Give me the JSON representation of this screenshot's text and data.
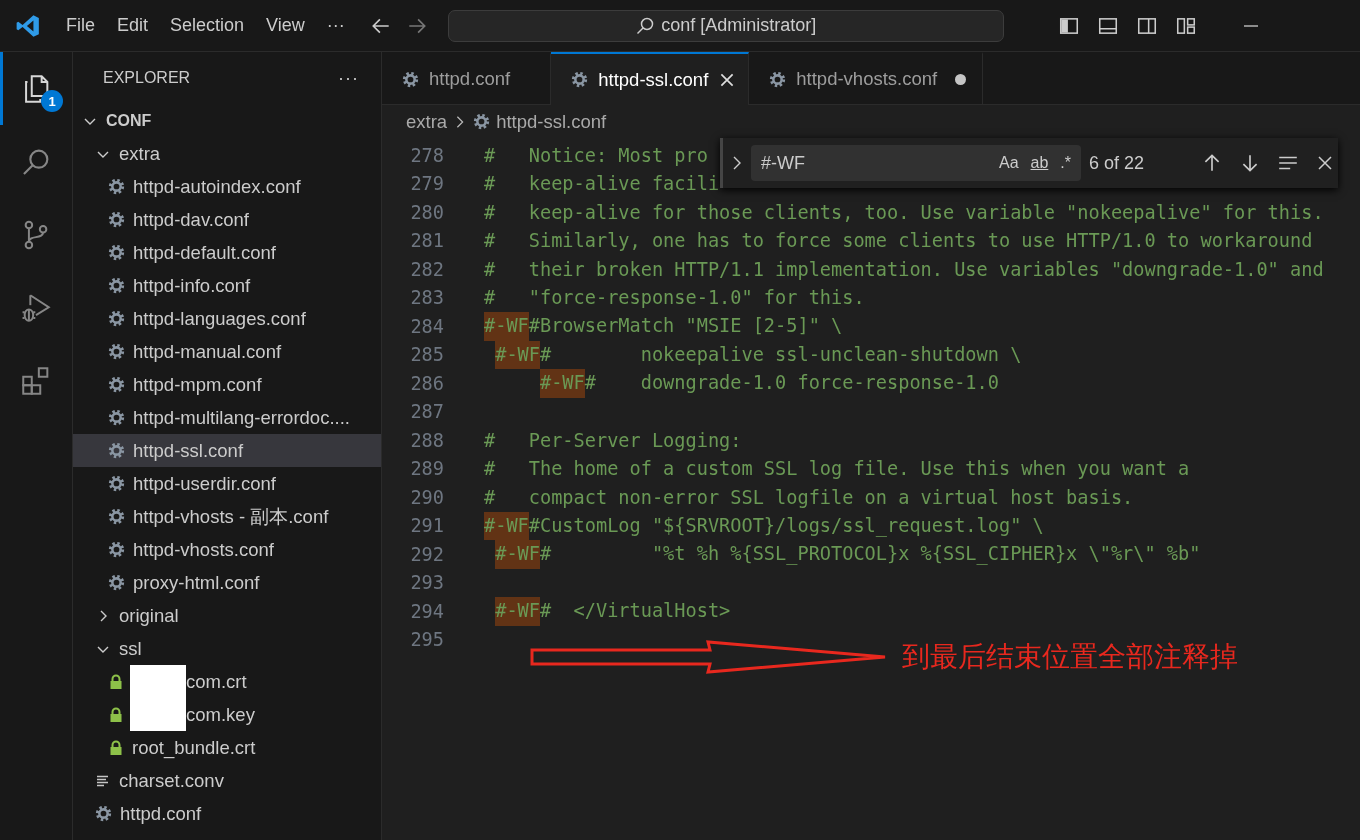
{
  "title_bar": {
    "menu": [
      "File",
      "Edit",
      "Selection",
      "View",
      "···"
    ],
    "command_center": "conf [Administrator]"
  },
  "activity_bar": [
    {
      "kind": "explorer",
      "selected": true,
      "badge": "1"
    },
    {
      "kind": "search",
      "selected": false
    },
    {
      "kind": "source-control",
      "selected": false
    },
    {
      "kind": "run-debug",
      "selected": false
    },
    {
      "kind": "extensions",
      "selected": false
    }
  ],
  "sidebar": {
    "title": "EXPLORER",
    "more": "···",
    "tree": [
      {
        "label": "CONF",
        "kind": "root",
        "expanded": true,
        "selected": false,
        "children": [
          {
            "label": "extra",
            "kind": "folder",
            "expanded": true,
            "selected": false,
            "children": [
              {
                "label": "httpd-autoindex.conf",
                "kind": "config",
                "selected": false
              },
              {
                "label": "httpd-dav.conf",
                "kind": "config",
                "selected": false
              },
              {
                "label": "httpd-default.conf",
                "kind": "config",
                "selected": false
              },
              {
                "label": "httpd-info.conf",
                "kind": "config",
                "selected": false
              },
              {
                "label": "httpd-languages.conf",
                "kind": "config",
                "selected": false
              },
              {
                "label": "httpd-manual.conf",
                "kind": "config",
                "selected": false
              },
              {
                "label": "httpd-mpm.conf",
                "kind": "config",
                "selected": false
              },
              {
                "label": "httpd-multilang-errordoc....",
                "kind": "config",
                "selected": false
              },
              {
                "label": "httpd-ssl.conf",
                "kind": "config",
                "selected": true
              },
              {
                "label": "httpd-userdir.conf",
                "kind": "config",
                "selected": false
              },
              {
                "label": "httpd-vhosts - 副本.conf",
                "kind": "config",
                "selected": false
              },
              {
                "label": "httpd-vhosts.conf",
                "kind": "config",
                "selected": false
              },
              {
                "label": "proxy-html.conf",
                "kind": "config",
                "selected": false
              }
            ]
          },
          {
            "label": "original",
            "kind": "folder",
            "expanded": false,
            "selected": false
          },
          {
            "label": "ssl",
            "kind": "folder",
            "expanded": true,
            "selected": false,
            "children": [
              {
                "label": "com.crt",
                "kind": "certificate",
                "redacted": true,
                "selected": false
              },
              {
                "label": "com.key",
                "kind": "certificate",
                "redacted": true,
                "selected": false
              },
              {
                "label": "root_bundle.crt",
                "kind": "certificate",
                "redacted": false,
                "selected": false
              }
            ]
          },
          {
            "label": "charset.conv",
            "kind": "text",
            "selected": false
          },
          {
            "label": "httpd.conf",
            "kind": "config",
            "selected": false
          }
        ]
      }
    ]
  },
  "tabs": [
    {
      "label": "httpd.conf",
      "selected": false,
      "modified": false
    },
    {
      "label": "httpd-ssl.conf",
      "selected": true,
      "modified": false
    },
    {
      "label": "httpd-vhosts.conf",
      "selected": false,
      "modified": true
    }
  ],
  "breadcrumbs": [
    "extra",
    "httpd-ssl.conf"
  ],
  "find_widget": {
    "value": "#-WF",
    "options": [
      {
        "label": "Aa",
        "kind": "case",
        "on": false
      },
      {
        "label": "ab",
        "kind": "word",
        "on": false
      },
      {
        "label": ".*",
        "kind": "regex",
        "on": false
      }
    ],
    "count": "6 of 22"
  },
  "code_lines": [
    {
      "number": "278",
      "kind": "flush",
      "parts": [
        {
          "text": "#   Notice: Most pro",
          "match": false
        }
      ]
    },
    {
      "number": "279",
      "kind": "flush",
      "parts": [
        {
          "text": "#   keep-alive facili",
          "match": false
        }
      ]
    },
    {
      "number": "280",
      "kind": "flush",
      "parts": [
        {
          "text": "#   keep-alive for those clients, too. Use variable \"nokeepalive\" for this.",
          "match": false
        }
      ]
    },
    {
      "number": "281",
      "kind": "flush",
      "parts": [
        {
          "text": "#   Similarly, one has to force some clients to use HTTP/1.0 to workaround",
          "match": false
        }
      ]
    },
    {
      "number": "282",
      "kind": "flush",
      "parts": [
        {
          "text": "#   their broken HTTP/1.1 implementation. Use variables \"downgrade-1.0\" and",
          "match": false
        }
      ]
    },
    {
      "number": "283",
      "kind": "flush",
      "parts": [
        {
          "text": "#   \"force-response-1.0\" for this.",
          "match": false
        }
      ]
    },
    {
      "number": "284",
      "kind": "flush",
      "parts": [
        {
          "text": "#-WF",
          "match": true
        },
        {
          "text": "#BrowserMatch \"MSIE [2-5]\" \\",
          "match": false
        }
      ]
    },
    {
      "number": "285",
      "kind": "nested",
      "parts": [
        {
          "text": "#-WF",
          "match": true
        },
        {
          "text": "#        nokeepalive ssl-unclean-shutdown \\",
          "match": false
        }
      ]
    },
    {
      "number": "286",
      "kind": "deep",
      "parts": [
        {
          "text": "#-WF",
          "match": true
        },
        {
          "text": "#    downgrade-1.0 force-response-1.0",
          "match": false
        }
      ]
    },
    {
      "number": "287"
    },
    {
      "number": "288",
      "kind": "flush",
      "parts": [
        {
          "text": "#   Per-Server Logging:",
          "match": false
        }
      ]
    },
    {
      "number": "289",
      "kind": "flush",
      "parts": [
        {
          "text": "#   The home of a custom SSL log file. Use this when you want a",
          "match": false
        }
      ]
    },
    {
      "number": "290",
      "kind": "flush",
      "parts": [
        {
          "text": "#   compact non-error SSL logfile on a virtual host basis.",
          "match": false
        }
      ]
    },
    {
      "number": "291",
      "kind": "flush",
      "parts": [
        {
          "text": "#-WF",
          "match": true
        },
        {
          "text": "#CustomLog \"${SRVROOT}/logs/ssl_request.log\" \\",
          "match": false
        }
      ]
    },
    {
      "number": "292",
      "kind": "nested",
      "parts": [
        {
          "text": "#-WF",
          "match": true
        },
        {
          "text": "#         \"%t %h %{SSL_PROTOCOL}x %{SSL_CIPHER}x \\\"%r\\\" %b\"",
          "match": false
        }
      ]
    },
    {
      "number": "293"
    },
    {
      "number": "294",
      "kind": "nested",
      "parts": [
        {
          "text": "#-WF",
          "match": true
        },
        {
          "text": "#  </VirtualHost>",
          "match": false
        }
      ]
    },
    {
      "number": "295"
    }
  ],
  "annotation": {
    "text": "到最后结束位置全部注释掉"
  }
}
